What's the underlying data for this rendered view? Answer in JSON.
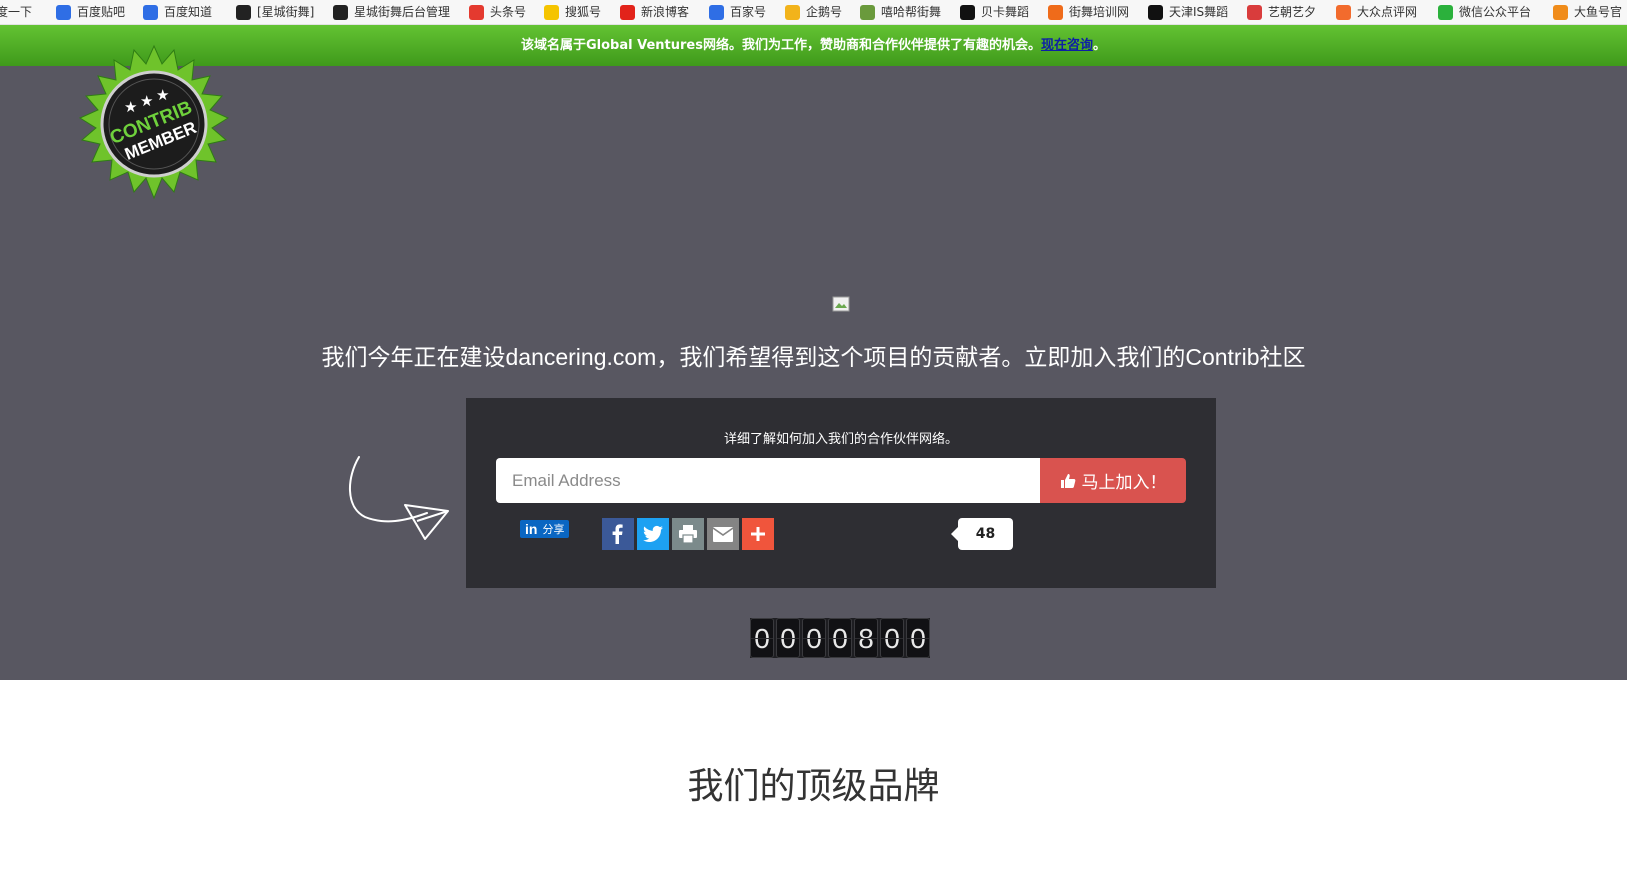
{
  "bookmarks": [
    {
      "label": "度一下",
      "icon": "baidu-icon",
      "color": "#2f6ee5"
    },
    {
      "label": "百度贴吧",
      "icon": "baidu-paw-icon",
      "color": "#2f6ee5"
    },
    {
      "label": "百度知道",
      "icon": "baidu-paw-icon",
      "color": "#2f6ee5"
    },
    {
      "label": "[星城街舞]",
      "icon": "s7-logo-icon",
      "color": "#222222"
    },
    {
      "label": "星城街舞后台管理",
      "icon": "s7-logo-icon",
      "color": "#222222"
    },
    {
      "label": "头条号",
      "icon": "toutiao-icon",
      "color": "#e43a2f"
    },
    {
      "label": "搜狐号",
      "icon": "sohu-icon",
      "color": "#f5c400"
    },
    {
      "label": "新浪博客",
      "icon": "sina-blog-icon",
      "color": "#e2231a"
    },
    {
      "label": "百家号",
      "icon": "baidu-paw-icon",
      "color": "#2f6ee5"
    },
    {
      "label": "企鹅号",
      "icon": "penguin-icon",
      "color": "#f2b31b"
    },
    {
      "label": "嘻哈帮街舞",
      "icon": "hiphop-icon",
      "color": "#6a9a3c"
    },
    {
      "label": "贝卡舞蹈",
      "icon": "c-logo-icon",
      "color": "#111111"
    },
    {
      "label": "街舞培训网",
      "icon": "dancer-icon",
      "color": "#ef6b1a"
    },
    {
      "label": "天津IS舞蹈",
      "icon": "swirl-icon",
      "color": "#111111"
    },
    {
      "label": "艺朝艺夕",
      "icon": "art-icon",
      "color": "#d93c3c"
    },
    {
      "label": "大众点评网",
      "icon": "dianping-icon",
      "color": "#f26b2d"
    },
    {
      "label": "微信公众平台",
      "icon": "wechat-icon",
      "color": "#2bb13c"
    },
    {
      "label": "大鱼号官",
      "icon": "fish-icon",
      "color": "#f08c1b"
    }
  ],
  "notice": {
    "text": "该域名属于Global Ventures网络。我们为工作，赞助商和合作伙伴提供了有趣的机会。",
    "link": "现在咨询",
    "end": "。"
  },
  "badge": {
    "line1": "CONTRIB",
    "line2": "MEMBER"
  },
  "headline": "我们今年正在建设dancering.com，我们希望得到这个项目的贡献者。立即加入我们的Contrib社区",
  "panel": {
    "title": "详细了解如何加入我们的合作伙伴网络。",
    "email_placeholder": "Email Address",
    "join_label": "马上加入！",
    "linkedin_label": "分享",
    "share_count": "48"
  },
  "counter_digits": [
    "0",
    "0",
    "0",
    "0",
    "8",
    "0",
    "0"
  ],
  "brands_title": "我们的顶级品牌",
  "colors": {
    "hero_bg": "#585761",
    "notice_green": "#4fae25",
    "join_red": "#d9534f"
  }
}
